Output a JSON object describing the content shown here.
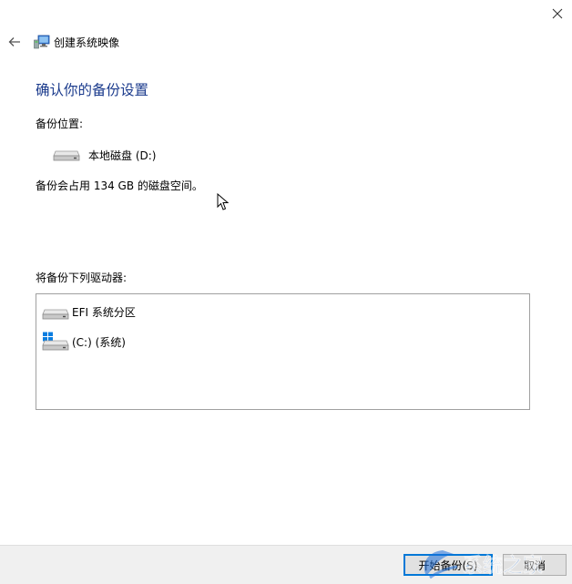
{
  "window": {
    "close_glyph": "✕",
    "title": "创建系统映像"
  },
  "content": {
    "heading": "确认你的备份设置",
    "location_label": "备份位置:",
    "location_value": "本地磁盘 (D:)",
    "space_note": "备份会占用 134 GB 的磁盘空间。",
    "drives_label": "将备份下列驱动器:",
    "drives": [
      {
        "label": "EFI 系统分区",
        "icon": "hard-drive-icon"
      },
      {
        "label": "(C:) (系统)",
        "icon": "windows-drive-icon"
      }
    ]
  },
  "footer": {
    "start_button": "开始备份(S)",
    "cancel_button": "取消"
  },
  "watermark": {
    "text": "系统之家"
  },
  "colors": {
    "heading": "#1a3a8c",
    "primary_border": "#0078d7",
    "footer_bg": "#f0f0f0"
  }
}
